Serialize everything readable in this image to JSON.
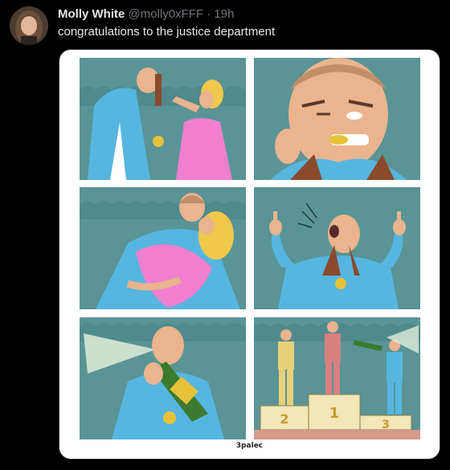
{
  "author": {
    "display_name": "Molly White",
    "handle": "@molly0xFFF",
    "separator": "·",
    "time": "19h"
  },
  "tweet": {
    "text": "congratulations to the justice department"
  },
  "media": {
    "panels": [
      {
        "name": "medal-ceremony"
      },
      {
        "name": "biting-medal"
      },
      {
        "name": "kiss"
      },
      {
        "name": "middle-fingers"
      },
      {
        "name": "champagne-spray"
      },
      {
        "name": "podium"
      }
    ],
    "podium_labels": [
      "2",
      "1",
      "3"
    ],
    "signature": "3palec"
  },
  "colors": {
    "teal": "#5a9496",
    "track_blue": "#56b6e0",
    "skin": "#e9b48e",
    "pink": "#f07fd0",
    "gold": "#e8c13a",
    "podium": "#f3e6b8",
    "champagne_green": "#3c7a2e"
  }
}
